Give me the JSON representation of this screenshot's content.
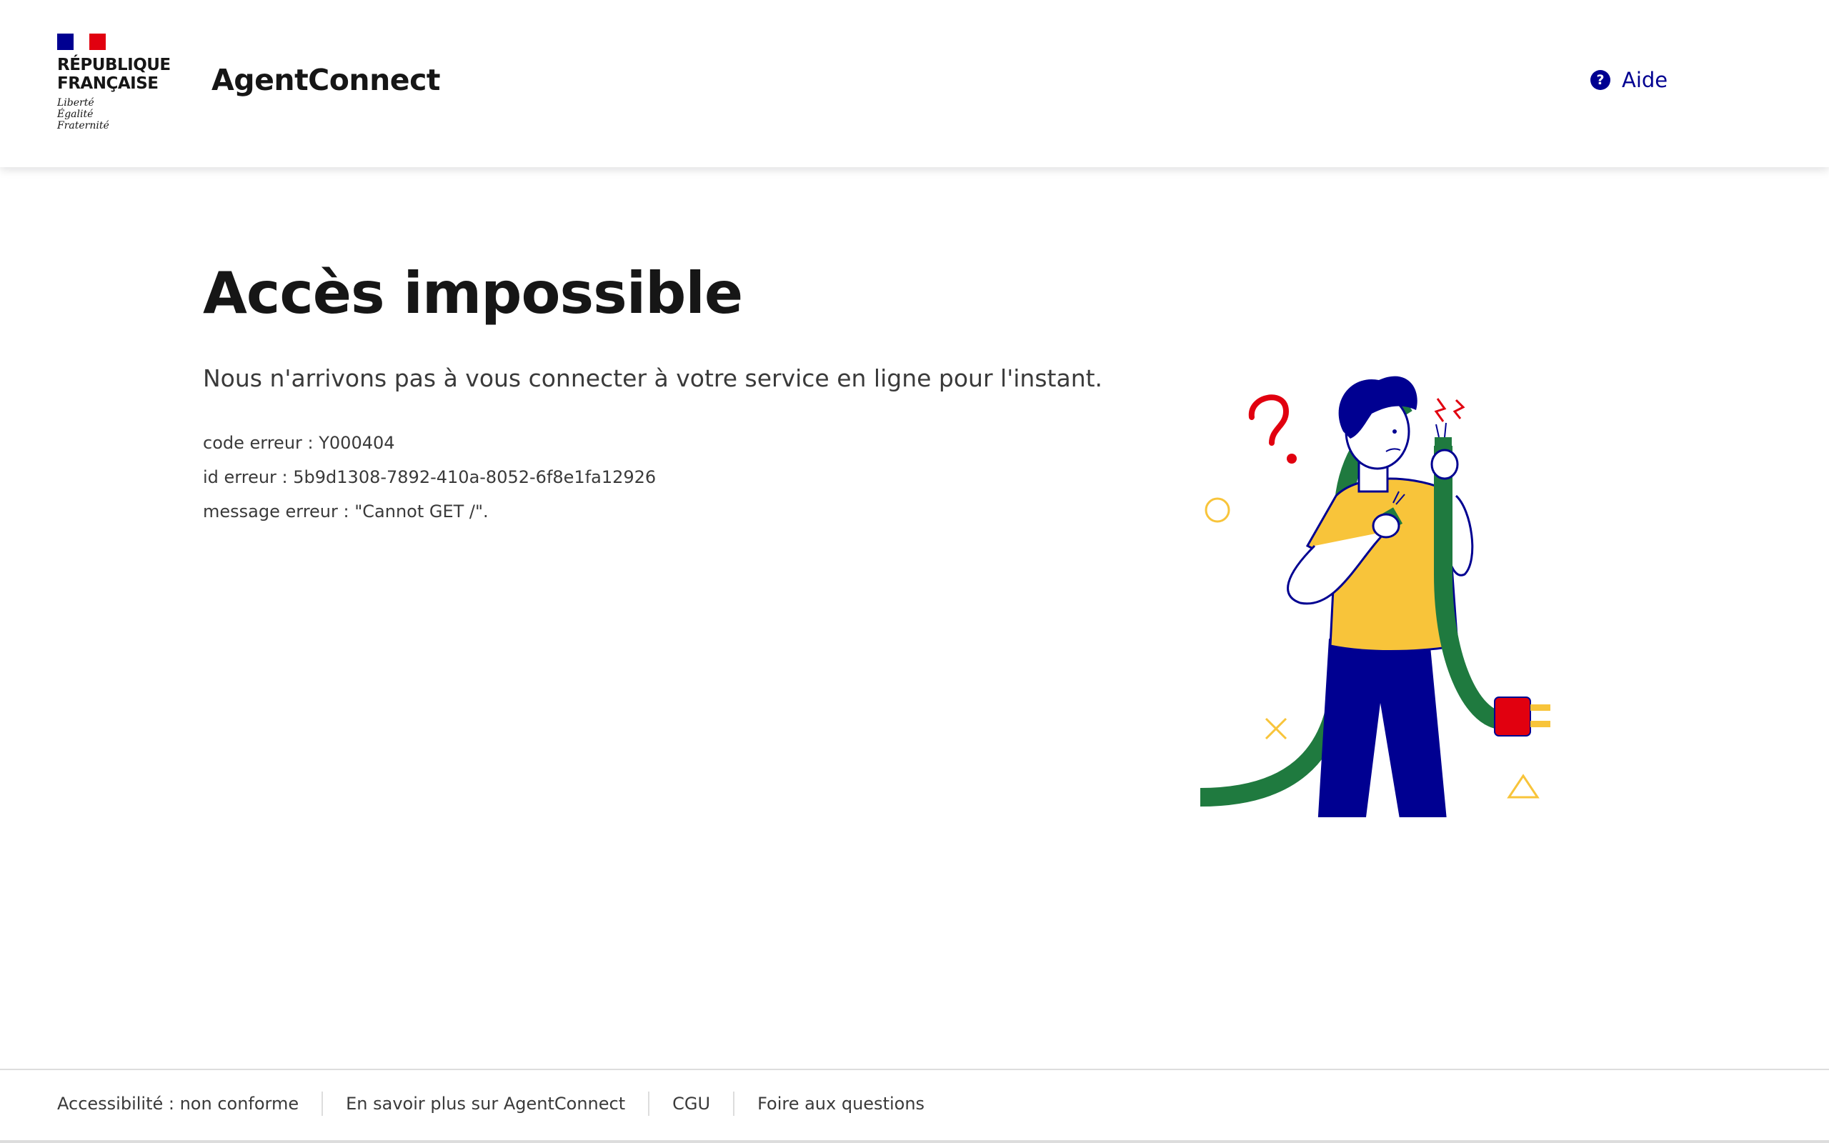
{
  "header": {
    "logo": {
      "line1": "RÉPUBLIQUE",
      "line2": "FRANÇAISE",
      "motto1": "Liberté",
      "motto2": "Égalité",
      "motto3": "Fraternité"
    },
    "service_name": "AgentConnect",
    "help_label": "Aide",
    "help_icon": "question-circle-icon"
  },
  "main": {
    "title": "Accès impossible",
    "lead": "Nous n'arrivons pas à vous connecter à votre service en ligne pour l'instant.",
    "error_code": "code erreur : Y000404",
    "error_id": "id erreur : 5b9d1308-7892-410a-8052-6f8e1fa12926",
    "error_message": "message erreur : \"Cannot GET /\"."
  },
  "footer": {
    "links": [
      "Accessibilité : non conforme",
      "En savoir plus sur AgentConnect",
      "CGU",
      "Foire aux questions"
    ]
  },
  "colors": {
    "brand_blue": "#000091",
    "marianne_red": "#e1000f",
    "illustration_green": "#1f7a3f",
    "illustration_yellow": "#f8c43a"
  }
}
